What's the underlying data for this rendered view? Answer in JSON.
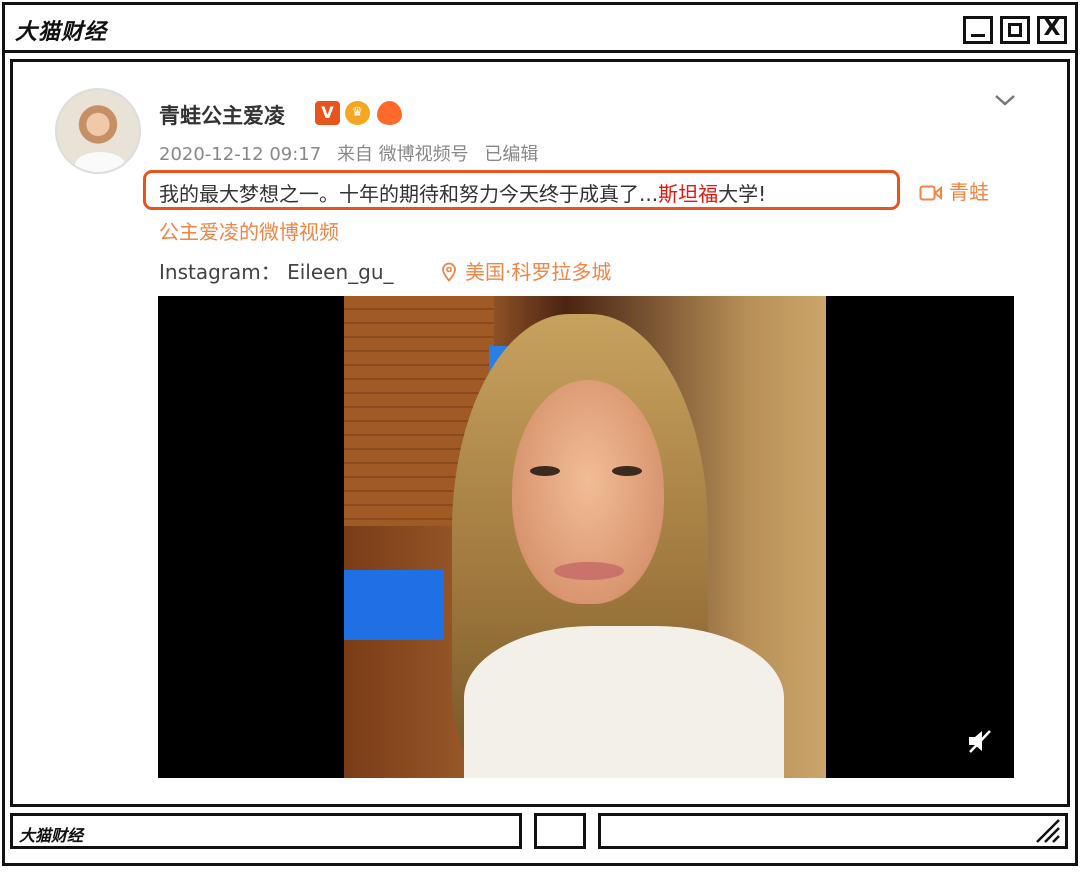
{
  "window": {
    "title": "大猫财经",
    "statusbar_label": "大猫财经",
    "close_glyph": "X"
  },
  "post": {
    "username": "青蛙公主爱凌",
    "badges": {
      "verified": "V",
      "crown": "♛",
      "fire": "🔥"
    },
    "date": "2020-12-12 09:17",
    "source": "来自 微博视频号",
    "edited": "已编辑",
    "text_before": "我的最大梦想之一。十年的期待和努力今天终于成真了...",
    "text_highlight": "斯坦福",
    "text_after": "大学!",
    "video_link_line1": "青蛙",
    "video_link_line2": "公主爱凌的微博视频",
    "instagram": "Instagram：  Eileen_gu_",
    "location": "美国·科罗拉多城"
  },
  "icons": {
    "expand": "chevron-down-icon",
    "video_camera": "video-camera-icon",
    "location": "location-pin-icon",
    "mute": "mute-icon",
    "resize": "resize-grip-icon"
  },
  "colors": {
    "accent": "#e8541e",
    "link": "#f08545",
    "highlight_text": "#e8150f",
    "meta_text": "#888888",
    "window_border": "#111111"
  }
}
